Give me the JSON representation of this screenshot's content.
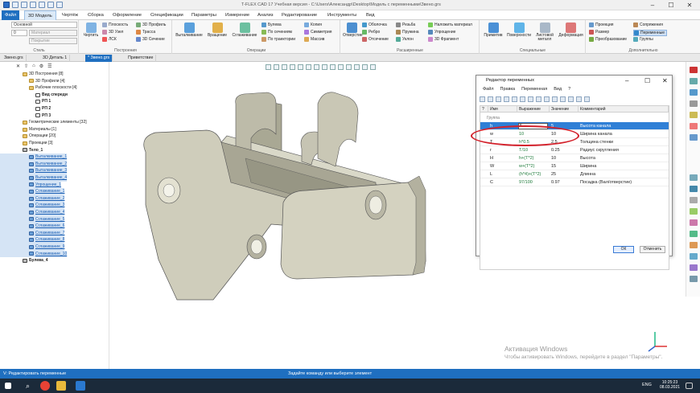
{
  "window": {
    "title": "T-FLEX CAD 17 Учебная версия - C:\\Users\\Александр\\Desktop\\Модель с переменными\\Звено.grs"
  },
  "menubar": {
    "items": [
      "Файл",
      "3D Модель",
      "Чертёж",
      "Сборка",
      "Оформление",
      "Спецификации",
      "Параметры",
      "Измерение",
      "Анализ",
      "Редактирование",
      "Инструменты",
      "Вид"
    ]
  },
  "ribbon": {
    "style_combo": "Основной",
    "layer_combo": "0",
    "material_combo": "Материал",
    "coating_combo": "Покрытие",
    "style_label": "Стиль",
    "construct": {
      "sketch": "Чертить",
      "plane": "Плоскость",
      "node": "3D Узел",
      "lcs": "ЛСК",
      "profile": "3D Профиль",
      "path": "Трасса",
      "section": "3D Сечение",
      "label": "Построения"
    },
    "ops": {
      "extrude": "Выталкивание",
      "rotate": "Вращение",
      "loft": "Сглаживание",
      "bool": "Булева",
      "sections": "По сечениям",
      "sweep": "По траектории",
      "copy": "Копия",
      "symmetry": "Симметрия",
      "array": "Массив",
      "label": "Операции"
    },
    "adv": {
      "hole": "Отверстие",
      "shell": "Оболочка",
      "rib": "Ребро",
      "cut": "Отсечение",
      "thread": "Резьба",
      "spring": "Пружина",
      "bend": "Уклон",
      "material": "Наложить материал",
      "simplify": "Упрощение",
      "fragment": "3D Фрагмент",
      "label": "Расширенные"
    },
    "special": {
      "primitives": "Примитив",
      "surfaces": "Поверхности",
      "sheetmetal": "Листовой металл",
      "deform": "Деформация",
      "label": "Специальные"
    },
    "extra": {
      "projection": "Проекция",
      "size": "Размер",
      "transform": "Преобразование",
      "mates": "Сопряжения",
      "variables": "Переменные",
      "groups": "Группы",
      "label": "Дополнительно"
    }
  },
  "doctabs": [
    "Звено.grs",
    "3D Деталь 1",
    "* Звено.grs",
    "Приветствие"
  ],
  "tree": [
    {
      "label": "3D Построения [8]",
      "indent": 0,
      "icon": "folder",
      "bold": false
    },
    {
      "label": "3D Профили [4]",
      "indent": 1,
      "icon": "folder",
      "bold": false
    },
    {
      "label": "Рабочие плоскости [4]",
      "indent": 1,
      "icon": "folder",
      "bold": false
    },
    {
      "label": "Вид спереди",
      "indent": 2,
      "icon": "plane",
      "bold": true
    },
    {
      "label": "РП 1",
      "indent": 2,
      "icon": "plane",
      "bold": true
    },
    {
      "label": "РП 2",
      "indent": 2,
      "icon": "plane",
      "bold": true
    },
    {
      "label": "РП 3",
      "indent": 2,
      "icon": "plane",
      "bold": true
    },
    {
      "label": "Геометрические элементы [32]",
      "indent": 0,
      "icon": "folder",
      "bold": false
    },
    {
      "label": "Материалы [1]",
      "indent": 0,
      "icon": "folder",
      "bold": false
    },
    {
      "label": "Операции [20]",
      "indent": 0,
      "icon": "folder",
      "bold": false
    },
    {
      "label": "Проекции [3]",
      "indent": 0,
      "icon": "folder",
      "bold": false
    },
    {
      "label": "Тело_1",
      "indent": 0,
      "icon": "body",
      "bold": true
    },
    {
      "label": "Выталкивание_1",
      "indent": 1,
      "icon": "op",
      "bold": false
    },
    {
      "label": "Выталкивание_2",
      "indent": 1,
      "icon": "op",
      "bold": false
    },
    {
      "label": "Выталкивание_3",
      "indent": 1,
      "icon": "op",
      "bold": false
    },
    {
      "label": "Выталкивание_4",
      "indent": 1,
      "icon": "op",
      "bold": false
    },
    {
      "label": "Упрощение_1",
      "indent": 1,
      "icon": "op",
      "bold": false
    },
    {
      "label": "Сглаживание_1",
      "indent": 1,
      "icon": "op",
      "bold": false
    },
    {
      "label": "Сглаживание_2",
      "indent": 1,
      "icon": "op",
      "bold": false
    },
    {
      "label": "Сглаживание_3",
      "indent": 1,
      "icon": "op",
      "bold": false
    },
    {
      "label": "Сглаживание_4",
      "indent": 1,
      "icon": "op",
      "bold": false
    },
    {
      "label": "Сглаживание_5",
      "indent": 1,
      "icon": "op",
      "bold": false
    },
    {
      "label": "Сглаживание_6",
      "indent": 1,
      "icon": "op",
      "bold": false
    },
    {
      "label": "Сглаживание_7",
      "indent": 1,
      "icon": "op",
      "bold": false
    },
    {
      "label": "Сглаживание_8",
      "indent": 1,
      "icon": "op",
      "bold": false
    },
    {
      "label": "Сглаживание_9",
      "indent": 1,
      "icon": "op",
      "bold": false
    },
    {
      "label": "Сглаживание_10",
      "indent": 1,
      "icon": "op",
      "bold": false
    },
    {
      "label": "Булева_4",
      "indent": 0,
      "icon": "body",
      "bold": true
    }
  ],
  "editor": {
    "title": "Редактор переменных",
    "menu": [
      "Файл",
      "Правка",
      "Переменная",
      "Вид",
      "?"
    ],
    "columns": [
      "?",
      "Имя",
      "Выражение",
      "Значение",
      "Комментарий"
    ],
    "group": "Группа",
    "rows": [
      {
        "name": "h",
        "expr": "5",
        "value": "5",
        "comment": "Высота канала"
      },
      {
        "name": "w",
        "expr": "10",
        "value": "10",
        "comment": "Ширина канала"
      },
      {
        "name": "T",
        "expr": "h*0.5",
        "value": "2.5",
        "comment": "Толщина стенки"
      },
      {
        "name": "r",
        "expr": "T/10",
        "value": "0.25",
        "comment": "Радиус скругления"
      },
      {
        "name": "H",
        "expr": "h+(T*2)",
        "value": "10",
        "comment": "Высота"
      },
      {
        "name": "W",
        "expr": "w+(T*2)",
        "value": "15",
        "comment": "Ширина"
      },
      {
        "name": "L",
        "expr": "(h*4)+(T*2)",
        "value": "25",
        "comment": "Длинна"
      },
      {
        "name": "C",
        "expr": "97/100",
        "value": "0.97",
        "comment": "Посадка (Вал/отверстие)"
      }
    ],
    "ok": "ОК",
    "cancel": "Отменить"
  },
  "watermark": {
    "line1": "Активация Windows",
    "line2": "Чтобы активировать Windows, перейдите в раздел \"Параметры\"."
  },
  "status": {
    "left": "V: Редактировать переменные",
    "center": "Задайте команду или выберите элемент"
  },
  "taskbar": {
    "lang": "ENG",
    "time": "10:25:23",
    "date": "08.03.2021"
  },
  "colors": {
    "accent": "#1f6fc0",
    "selection": "#2f7fd6",
    "expression": "#1e7b3a",
    "highlight_oval": "#d3202a"
  }
}
